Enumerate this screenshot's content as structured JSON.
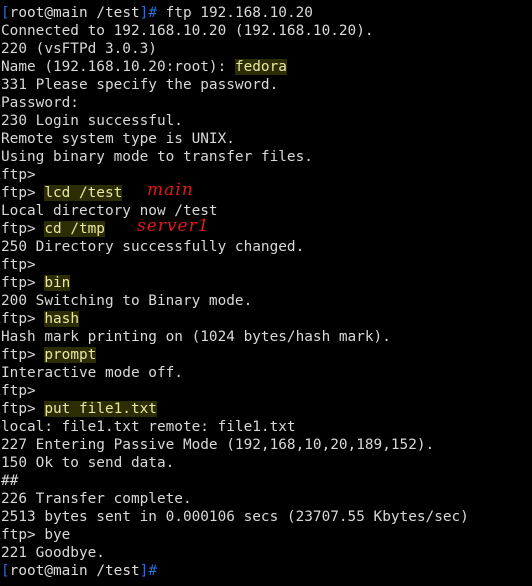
{
  "colors": {
    "background": "#000000",
    "text": "#d8d8d8",
    "bracket": "#2a6fd6",
    "highlight_bg": "#2d2d05",
    "annotation": "#e01818"
  },
  "prompt_start": {
    "open": "[",
    "user_host": "root@main",
    "dir": "/test",
    "close": "]#",
    "command": " ftp 192.168.10.20"
  },
  "lines": {
    "l1": "Connected to 192.168.10.20 (192.168.10.20).",
    "l2": "220 (vsFTPd 3.0.3)",
    "l3_prefix": "Name (192.168.10.20:root): ",
    "l3_value": "fedora",
    "l4": "331 Please specify the password.",
    "l5": "Password:",
    "l6": "230 Login successful.",
    "l7": "Remote system type is UNIX.",
    "l8": "Using binary mode to transfer files.",
    "l9": "ftp>",
    "l10_prefix": "ftp> ",
    "l10_cmd": "lcd /test",
    "l11": "Local directory now /test",
    "l12_prefix": "ftp> ",
    "l12_cmd": "cd /tmp",
    "l13": "250 Directory successfully changed.",
    "l14": "ftp>",
    "l15_prefix": "ftp> ",
    "l15_cmd": "bin",
    "l16": "200 Switching to Binary mode.",
    "l17_prefix": "ftp> ",
    "l17_cmd": "hash",
    "l18": "Hash mark printing on (1024 bytes/hash mark).",
    "l19_prefix": "ftp> ",
    "l19_cmd": "prompt",
    "l20": "Interactive mode off.",
    "l21": "ftp>",
    "l22_prefix": "ftp> ",
    "l22_cmd": "put file1.txt",
    "l23": "local: file1.txt remote: file1.txt",
    "l24": "227 Entering Passive Mode (192,168,10,20,189,152).",
    "l25": "150 Ok to send data.",
    "l26": "##",
    "l27": "226 Transfer complete.",
    "l28": "2513 bytes sent in 0.000106 secs (23707.55 Kbytes/sec)",
    "l29": "ftp> bye",
    "l30": "221 Goodbye."
  },
  "annotations": {
    "main": "main",
    "server": "server1"
  },
  "prompt_end": {
    "open": "[",
    "user_host": "root@main",
    "dir": "/test",
    "close": "]#"
  }
}
